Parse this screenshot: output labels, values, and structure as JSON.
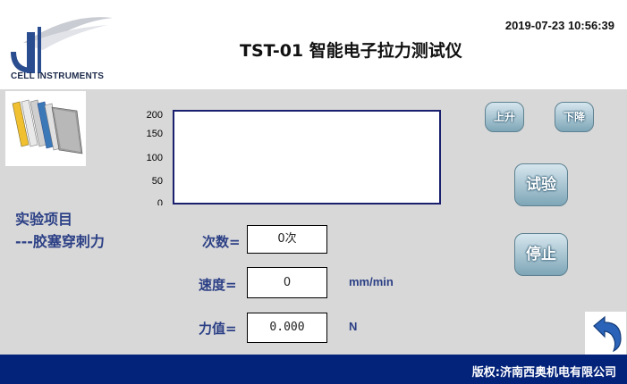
{
  "header": {
    "logo_text": "CELL INSTRUMENTS",
    "title": "TST-01  智能电子拉力测试仪",
    "datetime": "2019-07-23 10:56:39"
  },
  "chart_data": {
    "type": "line",
    "y_ticks": [
      "200",
      "150",
      "100",
      "50",
      "0"
    ],
    "ylim": [
      0,
      200
    ],
    "series": []
  },
  "project": {
    "line1": "实验项目",
    "line2": "---胶塞穿刺力"
  },
  "fields": {
    "count_label": "次数=",
    "count_value": "0次",
    "speed_label": "速度=",
    "speed_value": "0",
    "speed_unit": "mm/min",
    "force_label": "力值=",
    "force_value": "0.000",
    "force_unit": "N"
  },
  "buttons": {
    "up": "上升",
    "down": "下降",
    "test": "试验",
    "stop": "停止"
  },
  "footer": {
    "copyright": "版权:济南西奥机电有限公司"
  },
  "icons": {
    "logo": "cell-instruments-logo",
    "books": "books-icon",
    "back": "back-arrow-icon"
  },
  "colors": {
    "footer_bg": "#03237a",
    "label_text": "#2b3f85",
    "panel_bg": "#d8d8d8"
  }
}
